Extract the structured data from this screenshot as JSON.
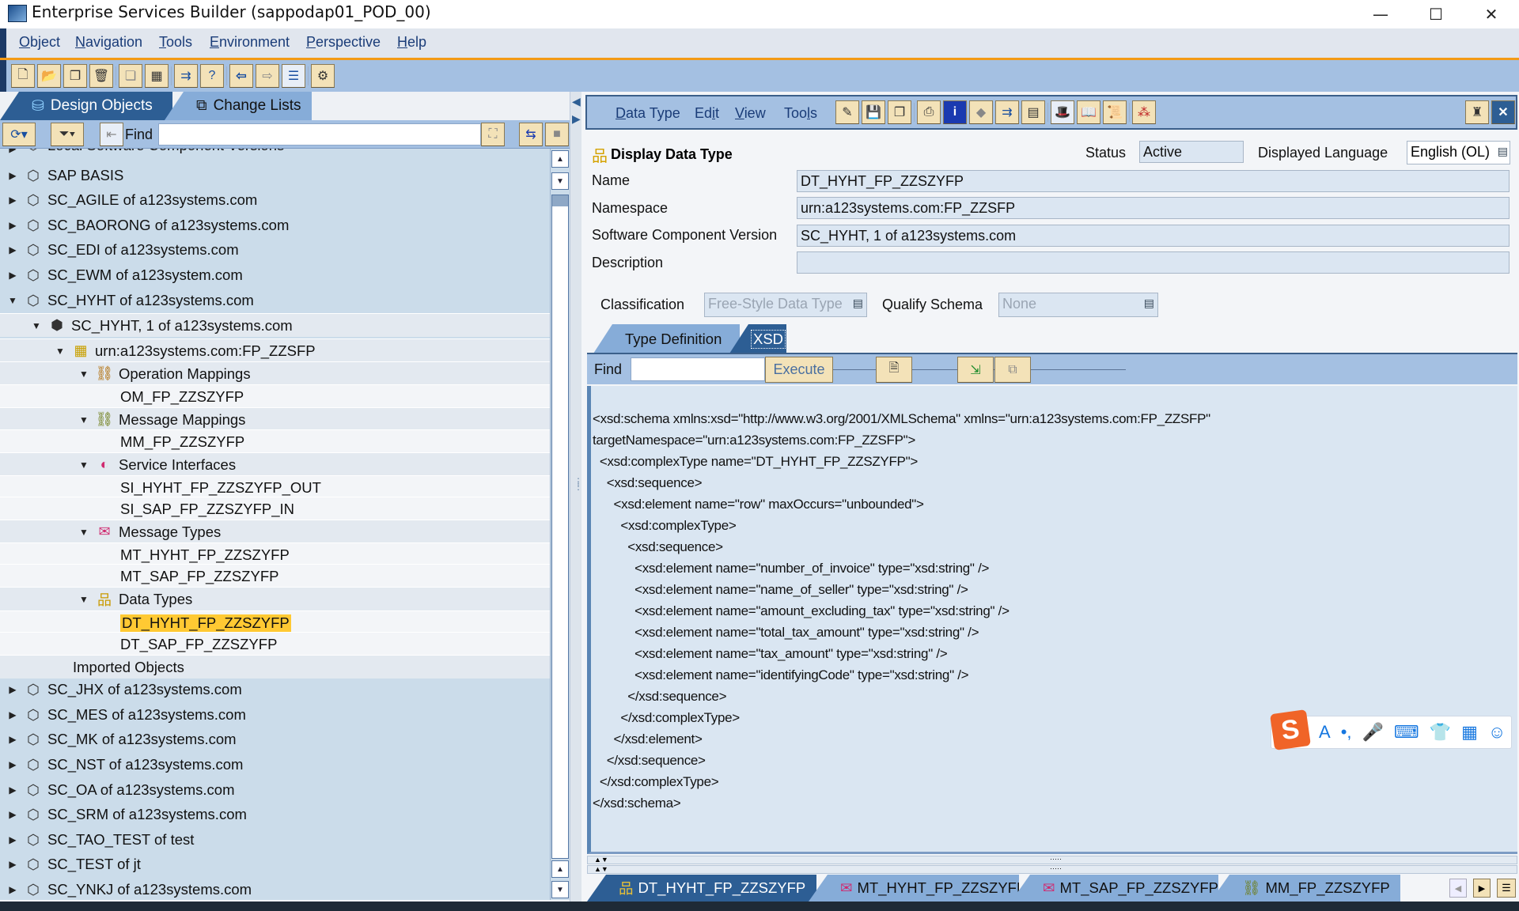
{
  "window": {
    "title": "Enterprise Services Builder (sappodap01_POD_00)",
    "controls": {
      "minimize": "—",
      "maximize": "☐",
      "close": "✕"
    }
  },
  "menu": [
    {
      "label": "Object",
      "mnemonic": "O"
    },
    {
      "label": "Navigation",
      "mnemonic": "N"
    },
    {
      "label": "Tools",
      "mnemonic": "T"
    },
    {
      "label": "Environment",
      "mnemonic": "E"
    },
    {
      "label": "Perspective",
      "mnemonic": "P"
    },
    {
      "label": "Help",
      "mnemonic": "H"
    }
  ],
  "toolbar": {
    "icons": [
      "new-icon",
      "open-icon",
      "copy-icon",
      "delete-icon",
      "copy-disabled-icon",
      "close-window-icon",
      "navigate-icon",
      "where-used-icon",
      "back-icon",
      "forward-icon",
      "list-icon",
      "settings-icon"
    ]
  },
  "left_tabs": [
    {
      "label": "Design Objects",
      "active": true
    },
    {
      "label": "Change Lists",
      "active": false
    }
  ],
  "left_find": {
    "label": "Find",
    "value": ""
  },
  "tree": [
    {
      "label": "Local Software Component Versions",
      "level": 0,
      "expand": "collapsed",
      "icon": "swc-icon",
      "partial": true
    },
    {
      "label": "SAP BASIS",
      "level": 0,
      "expand": "collapsed",
      "icon": "swc-icon"
    },
    {
      "label": "SC_AGILE of a123systems.com",
      "level": 0,
      "expand": "collapsed",
      "icon": "swc-icon"
    },
    {
      "label": "SC_BAORONG of a123systems.com",
      "level": 0,
      "expand": "collapsed",
      "icon": "swc-icon"
    },
    {
      "label": "SC_EDI of a123systems.com",
      "level": 0,
      "expand": "collapsed",
      "icon": "swc-icon"
    },
    {
      "label": "SC_EWM of a123system.com",
      "level": 0,
      "expand": "collapsed",
      "icon": "swc-icon"
    },
    {
      "label": "SC_HYHT of a123systems.com",
      "level": 0,
      "expand": "expanded",
      "icon": "swc-icon"
    },
    {
      "label": "SC_HYHT, 1 of a123systems.com",
      "level": 1,
      "expand": "expanded",
      "icon": "swcv-icon"
    },
    {
      "label": "urn:a123systems.com:FP_ZZSFP",
      "level": 2,
      "expand": "expanded",
      "icon": "namespace-icon"
    },
    {
      "label": "Operation Mappings",
      "level": 3,
      "expand": "expanded",
      "icon": "operation-mapping-icon"
    },
    {
      "label": "OM_FP_ZZSZYFP",
      "level": 4,
      "expand": "none",
      "icon": ""
    },
    {
      "label": "Message Mappings",
      "level": 3,
      "expand": "expanded",
      "icon": "message-mapping-icon"
    },
    {
      "label": "MM_FP_ZZSZYFP",
      "level": 4,
      "expand": "none",
      "icon": ""
    },
    {
      "label": "Service Interfaces",
      "level": 3,
      "expand": "expanded",
      "icon": "service-interface-icon"
    },
    {
      "label": "SI_HYHT_FP_ZZSZYFP_OUT",
      "level": 4,
      "expand": "none",
      "icon": ""
    },
    {
      "label": "SI_SAP_FP_ZZSZYFP_IN",
      "level": 4,
      "expand": "none",
      "icon": ""
    },
    {
      "label": "Message Types",
      "level": 3,
      "expand": "expanded",
      "icon": "message-type-icon"
    },
    {
      "label": "MT_HYHT_FP_ZZSZYFP",
      "level": 4,
      "expand": "none",
      "icon": ""
    },
    {
      "label": "MT_SAP_FP_ZZSZYFP",
      "level": 4,
      "expand": "none",
      "icon": ""
    },
    {
      "label": "Data Types",
      "level": 3,
      "expand": "expanded",
      "icon": "data-type-icon"
    },
    {
      "label": "DT_HYHT_FP_ZZSZYFP",
      "level": 4,
      "expand": "none",
      "icon": "",
      "selected": true
    },
    {
      "label": "DT_SAP_FP_ZZSZYFP",
      "level": 4,
      "expand": "none",
      "icon": ""
    },
    {
      "label": "Imported Objects",
      "level": 1,
      "expand": "none",
      "icon": ""
    },
    {
      "label": "SC_JHX of a123systems.com",
      "level": 0,
      "expand": "collapsed",
      "icon": "swc-icon"
    },
    {
      "label": "SC_MES of a123systems.com",
      "level": 0,
      "expand": "collapsed",
      "icon": "swc-icon"
    },
    {
      "label": "SC_MK of a123systems.com",
      "level": 0,
      "expand": "collapsed",
      "icon": "swc-icon"
    },
    {
      "label": "SC_NST of a123systems.com",
      "level": 0,
      "expand": "collapsed",
      "icon": "swc-icon"
    },
    {
      "label": "SC_OA of a123systems.com",
      "level": 0,
      "expand": "collapsed",
      "icon": "swc-icon"
    },
    {
      "label": "SC_SRM of a123systems.com",
      "level": 0,
      "expand": "collapsed",
      "icon": "swc-icon"
    },
    {
      "label": "SC_TAO_TEST of test",
      "level": 0,
      "expand": "collapsed",
      "icon": "swc-icon"
    },
    {
      "label": "SC_TEST of jt",
      "level": 0,
      "expand": "collapsed",
      "icon": "swc-icon"
    },
    {
      "label": "SC_YNKJ of a123systems.com",
      "level": 0,
      "expand": "collapsed",
      "icon": "swc-icon"
    }
  ],
  "editor": {
    "menu": [
      {
        "label": "Data Type",
        "mnemonic": "D"
      },
      {
        "label": "Edit",
        "mnemonic": "i"
      },
      {
        "label": "View",
        "mnemonic": "V"
      },
      {
        "label": "Tools",
        "mnemonic": "l"
      }
    ],
    "heading": "Display Data Type",
    "status_label": "Status",
    "status_value": "Active",
    "language_label": "Displayed Language",
    "language_value": "English (OL)",
    "fields": {
      "name_label": "Name",
      "name_value": "DT_HYHT_FP_ZZSZYFP",
      "namespace_label": "Namespace",
      "namespace_value": "urn:a123systems.com:FP_ZZSFP",
      "swcv_label": "Software Component Version",
      "swcv_value": "SC_HYHT, 1 of a123systems.com",
      "description_label": "Description",
      "description_value": ""
    },
    "classification_label": "Classification",
    "classification_value": "Free-Style Data Type",
    "qualify_label": "Qualify Schema",
    "qualify_value": "None",
    "tabs": [
      {
        "label": "Type Definition",
        "active": false
      },
      {
        "label": "XSD",
        "active": true
      }
    ],
    "find_label": "Find",
    "find_value": "",
    "execute_label": "Execute",
    "xsd_lines": [
      "<xsd:schema xmlns:xsd=\"http://www.w3.org/2001/XMLSchema\" xmlns=\"urn:a123systems.com:FP_ZZSFP\"",
      "targetNamespace=\"urn:a123systems.com:FP_ZZSFP\">",
      "  <xsd:complexType name=\"DT_HYHT_FP_ZZSZYFP\">",
      "    <xsd:sequence>",
      "      <xsd:element name=\"row\" maxOccurs=\"unbounded\">",
      "        <xsd:complexType>",
      "          <xsd:sequence>",
      "            <xsd:element name=\"number_of_invoice\" type=\"xsd:string\" />",
      "            <xsd:element name=\"name_of_seller\" type=\"xsd:string\" />",
      "            <xsd:element name=\"amount_excluding_tax\" type=\"xsd:string\" />",
      "            <xsd:element name=\"total_tax_amount\" type=\"xsd:string\" />",
      "            <xsd:element name=\"tax_amount\" type=\"xsd:string\" />",
      "            <xsd:element name=\"identifyingCode\" type=\"xsd:string\" />",
      "          </xsd:sequence>",
      "        </xsd:complexType>",
      "      </xsd:element>",
      "    </xsd:sequence>",
      "  </xsd:complexType>",
      "</xsd:schema>"
    ]
  },
  "bottom_tabs": [
    {
      "label": "DT_HYHT_FP_ZZSZYFP",
      "icon": "data-type-icon",
      "active": true
    },
    {
      "label": "MT_HYHT_FP_ZZSZYFP",
      "icon": "message-type-icon",
      "active": false
    },
    {
      "label": "MT_SAP_FP_ZZSZYFP",
      "icon": "message-type-icon",
      "active": false
    },
    {
      "label": "MM_FP_ZZSZYFP",
      "icon": "message-mapping-icon",
      "active": false
    }
  ],
  "ime_toolbar": {
    "logo": "S",
    "items": [
      "A",
      "•,",
      "🎤",
      "⌨",
      "👕",
      "▦",
      "☺"
    ]
  },
  "colors": {
    "accent_orange": "#f39a16",
    "selection": "#ffc933",
    "toolbar_blue": "#a4c0e2",
    "active_tab": "#2d5e94"
  }
}
